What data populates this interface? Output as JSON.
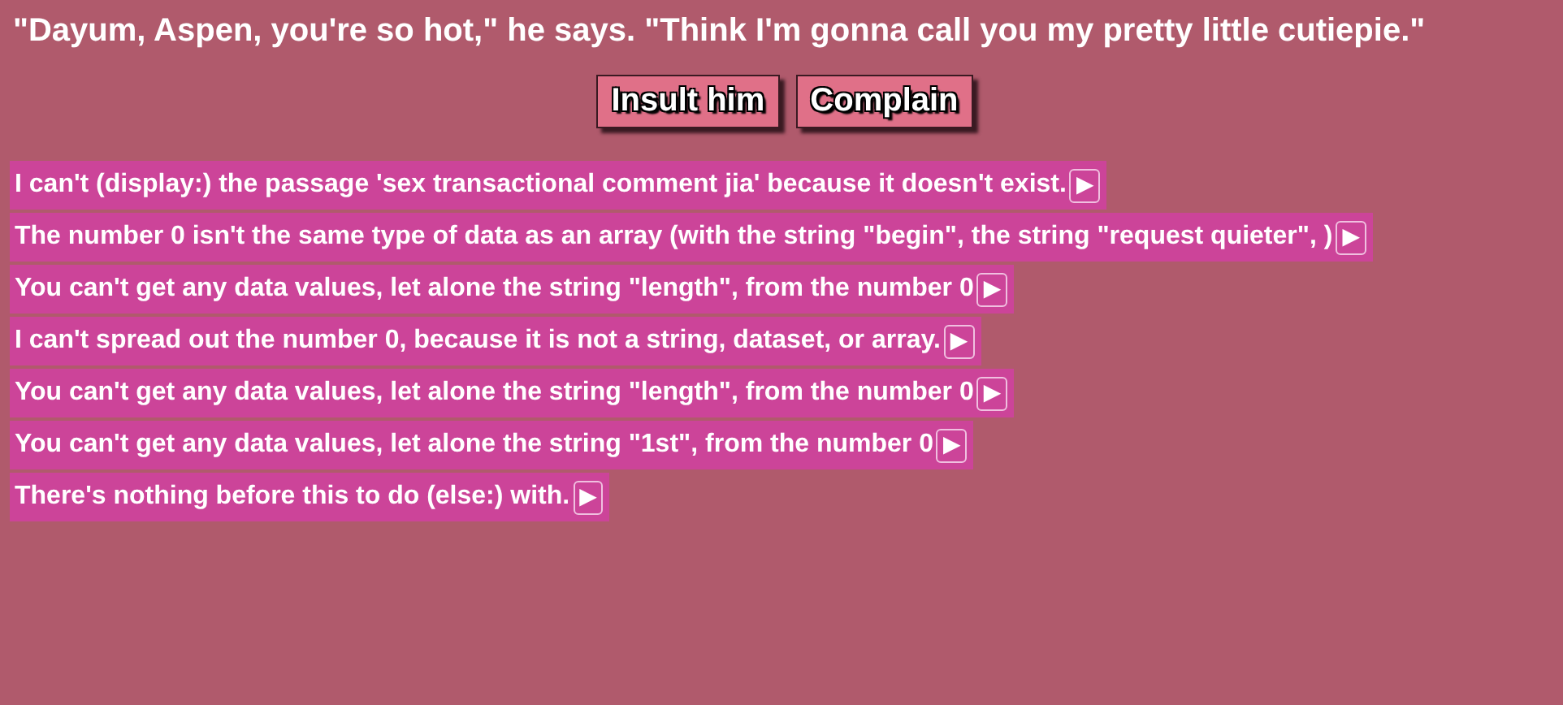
{
  "passage": {
    "text": "\"Dayum, Aspen, you're so hot,\" he says. \"Think I'm gonna call you my pretty little cutiepie.\""
  },
  "choices": [
    {
      "label": "Insult him"
    },
    {
      "label": "Complain"
    }
  ],
  "errors": [
    {
      "message": "I can't (display:) the passage 'sex transactional comment jia' because it doesn't exist.",
      "toggle": "▶"
    },
    {
      "message": "The number 0 isn't the same type of data as an array (with the string \"begin\", the string \"request quieter\", )",
      "toggle": "▶"
    },
    {
      "message": "You can't get any data values, let alone the string \"length\", from the number 0",
      "toggle": "▶"
    },
    {
      "message": "I can't spread out the number 0, because it is not a string, dataset, or array.",
      "toggle": "▶"
    },
    {
      "message": "You can't get any data values, let alone the string \"length\", from the number 0",
      "toggle": "▶"
    },
    {
      "message": "You can't get any data values, let alone the string \"1st\", from the number 0",
      "toggle": "▶"
    },
    {
      "message": "There's nothing before this to do (else:) with.",
      "toggle": "▶"
    }
  ]
}
